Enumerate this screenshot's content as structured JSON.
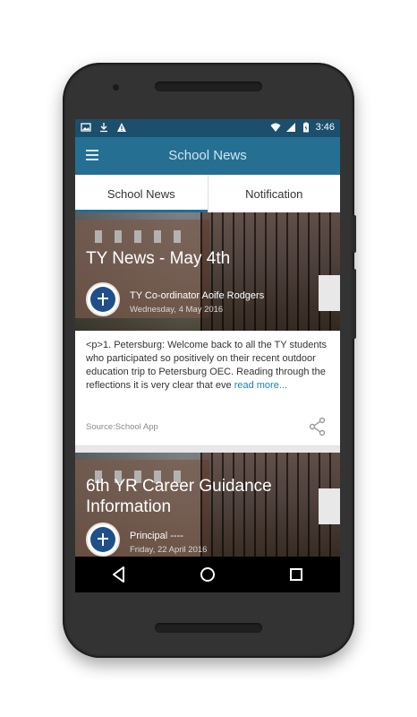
{
  "status_bar": {
    "time": "3:46",
    "icons": [
      "image-icon",
      "download-icon",
      "warning-icon",
      "wifi-icon",
      "signal-icon",
      "battery-icon"
    ]
  },
  "app_bar": {
    "title": "School News",
    "menu_icon": "hamburger-menu-icon"
  },
  "tabs": [
    {
      "label": "School News",
      "active": true
    },
    {
      "label": "Notification",
      "active": false
    }
  ],
  "posts": [
    {
      "title": "TY News - May 4th",
      "author": "TY Co-ordinator Aoife Rodgers",
      "date": "Wednesday, 4 May 2016",
      "excerpt": "<p>1. Petersburg: Welcome back to all the TY students who participated so positively on their recent outdoor education trip to Petersburg OEC. Reading through the reflections it is very clear that eve",
      "read_more": "read more...",
      "source": "Source:School App"
    },
    {
      "title": "6th YR Career Guidance Information",
      "author": "Principal ----",
      "date": "Friday, 22 April 2016"
    }
  ],
  "colors": {
    "status_bar": "#1b4f6c",
    "app_bar": "#256f92",
    "tab_indicator": "#1e6f98",
    "link": "#1e7fb0"
  }
}
